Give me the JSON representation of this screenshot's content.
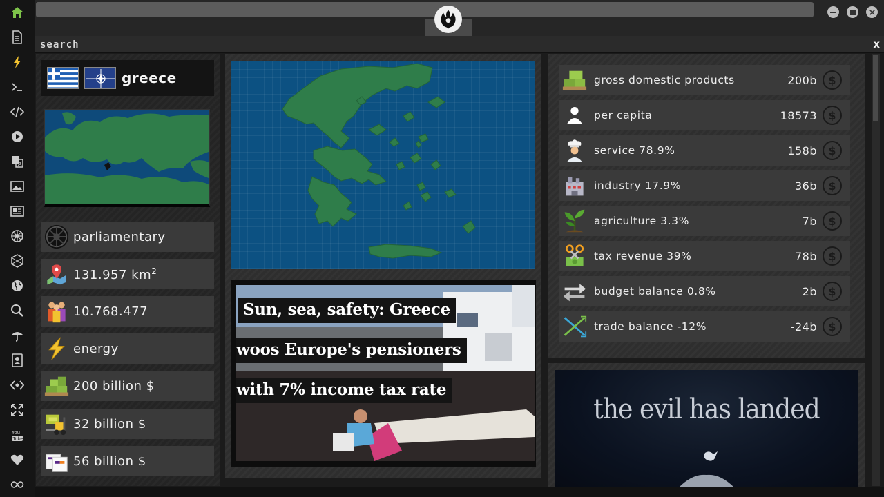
{
  "search": {
    "placeholder": "search",
    "close": "x"
  },
  "country": {
    "name": "greece"
  },
  "left_stats": [
    {
      "icon": "imperial-emblem-icon",
      "text": "parliamentary"
    },
    {
      "icon": "map-pin-icon",
      "text": "131.957 km",
      "sup": "2"
    },
    {
      "icon": "population-icon",
      "text": "10.768.477"
    },
    {
      "icon": "lightning-icon",
      "text": "energy"
    },
    {
      "icon": "cash-stack-icon",
      "text": "200 billion $"
    },
    {
      "icon": "forklift-icon",
      "text": "32 billion $"
    },
    {
      "icon": "shipping-box-icon",
      "text": "56 billion $"
    }
  ],
  "news": {
    "lines": [
      "Sun, sea, safety: Greece",
      "woos Europe's pensioners",
      "with 7% income tax rate"
    ]
  },
  "economy": [
    {
      "icon": "cash-pallet-icon",
      "label": "gross domestic products",
      "value": "200b"
    },
    {
      "icon": "person-icon",
      "label": "per capita",
      "value": "18573"
    },
    {
      "icon": "chef-icon",
      "label": "service 78.9%",
      "value": "158b"
    },
    {
      "icon": "factory-icon",
      "label": "industry 17.9%",
      "value": "36b"
    },
    {
      "icon": "plant-icon",
      "label": "agriculture 3.3%",
      "value": "7b"
    },
    {
      "icon": "scissors-money-icon",
      "label": "tax revenue 39%",
      "value": "78b"
    },
    {
      "icon": "balance-arrows-icon",
      "label": "budget balance 0.8%",
      "value": "2b"
    },
    {
      "icon": "trade-cross-icon",
      "label": "trade balance -12%",
      "value": "-24b"
    }
  ],
  "currency_symbol": "$",
  "ad": {
    "text": "the evil has landed"
  },
  "colors": {
    "accent": "#7ec34a",
    "map_sea": "#0c5182",
    "map_land": "#2f7d4a"
  }
}
